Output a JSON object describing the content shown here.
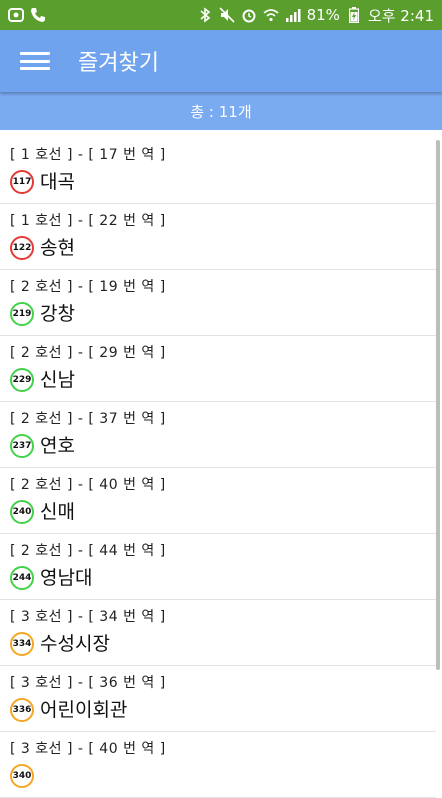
{
  "status_bar": {
    "battery": "81%",
    "time": "오후 2:41"
  },
  "app_bar": {
    "title": "즐겨찾기",
    "menu_icon": "hamburger-menu-icon"
  },
  "count_text": "총 : 11개",
  "line_colors": {
    "1": "#e53935",
    "2": "#43d14a",
    "3": "#f5a623"
  },
  "stations": [
    {
      "info": "[ 1 호선 ] - [ 17 번 역 ]",
      "line": "1",
      "code": "117",
      "name": "대곡"
    },
    {
      "info": "[ 1 호선 ] - [ 22 번 역 ]",
      "line": "1",
      "code": "122",
      "name": "송현"
    },
    {
      "info": "[ 2 호선 ] - [ 19 번 역 ]",
      "line": "2",
      "code": "219",
      "name": "강창"
    },
    {
      "info": "[ 2 호선 ] - [ 29 번 역 ]",
      "line": "2",
      "code": "229",
      "name": "신남"
    },
    {
      "info": "[ 2 호선 ] - [ 37 번 역 ]",
      "line": "2",
      "code": "237",
      "name": "연호"
    },
    {
      "info": "[ 2 호선 ] - [ 40 번 역 ]",
      "line": "2",
      "code": "240",
      "name": "신매"
    },
    {
      "info": "[ 2 호선 ] - [ 44 번 역 ]",
      "line": "2",
      "code": "244",
      "name": "영남대"
    },
    {
      "info": "[ 3 호선 ] - [ 34 번 역 ]",
      "line": "3",
      "code": "334",
      "name": "수성시장"
    },
    {
      "info": "[ 3 호선 ] - [ 36 번 역 ]",
      "line": "3",
      "code": "336",
      "name": "어린이회관"
    },
    {
      "info": "[ 3 호선 ] - [ 40 번 역 ]",
      "line": "3",
      "code": "340",
      "name": ""
    }
  ]
}
